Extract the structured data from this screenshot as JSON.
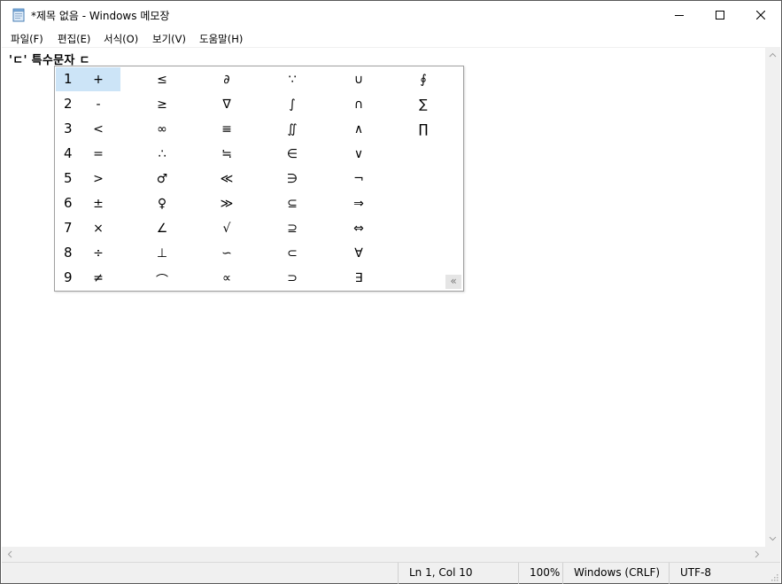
{
  "window": {
    "title": "*제목 없음 - Windows 메모장"
  },
  "icons": {
    "app": "notepad-icon",
    "minimize": "minimize-icon",
    "maximize": "maximize-icon",
    "close": "close-icon",
    "expand": "double-chevron-left-icon"
  },
  "menu": {
    "items": [
      {
        "label": "파일(F)"
      },
      {
        "label": "편집(E)"
      },
      {
        "label": "서식(O)"
      },
      {
        "label": "보기(V)"
      },
      {
        "label": "도움말(H)"
      }
    ]
  },
  "editor": {
    "text": "'ㄷ' 특수문자 ㄷ"
  },
  "ime": {
    "rows": [
      {
        "num": "1",
        "items": [
          "+",
          "≤",
          "∂",
          "∵",
          "∪",
          "∮"
        ]
      },
      {
        "num": "2",
        "items": [
          "-",
          "≥",
          "∇",
          "∫",
          "∩",
          "∑"
        ]
      },
      {
        "num": "3",
        "items": [
          "<",
          "∞",
          "≡",
          "∬",
          "∧",
          "∏"
        ]
      },
      {
        "num": "4",
        "items": [
          "=",
          "∴",
          "≒",
          "∈",
          "∨",
          ""
        ]
      },
      {
        "num": "5",
        "items": [
          ">",
          "♂",
          "≪",
          "∋",
          "¬",
          ""
        ]
      },
      {
        "num": "6",
        "items": [
          "±",
          "♀",
          "≫",
          "⊆",
          "⇒",
          ""
        ]
      },
      {
        "num": "7",
        "items": [
          "×",
          "∠",
          "√",
          "⊇",
          "⇔",
          ""
        ]
      },
      {
        "num": "8",
        "items": [
          "÷",
          "⊥",
          "∽",
          "⊂",
          "∀",
          ""
        ]
      },
      {
        "num": "9",
        "items": [
          "≠",
          "⌒",
          "∝",
          "⊃",
          "∃",
          ""
        ]
      }
    ],
    "expand_label": "«",
    "selected_index": 0
  },
  "statusbar": {
    "position": "Ln 1, Col 10",
    "zoom": "100%",
    "line_ending": "Windows (CRLF)",
    "encoding": "UTF-8"
  }
}
